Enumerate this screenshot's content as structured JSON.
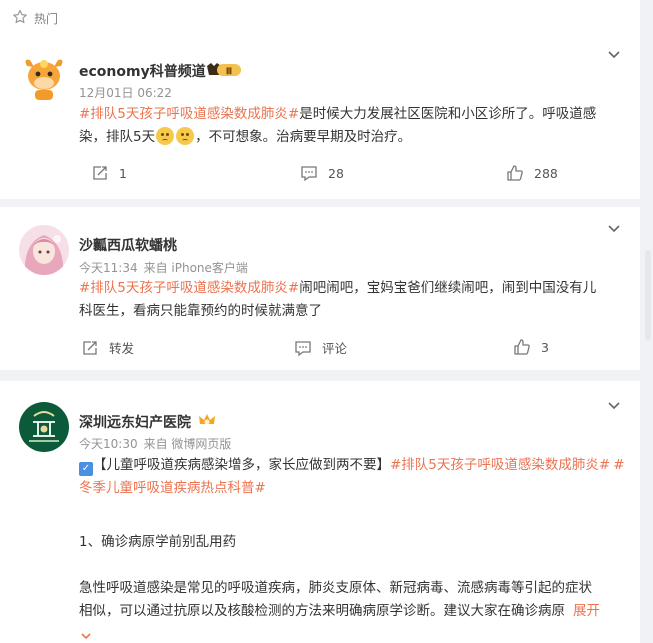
{
  "header": {
    "title": "热门",
    "icon": "star-outline-icon"
  },
  "posts": [
    {
      "author": "economy科普频道",
      "badge": "Ⅲ",
      "time": "12月01日 06:22",
      "source": "",
      "topic": "#排队5天孩子呼吸道感染数成肺炎#",
      "text_1": "是时候大力发展社区医院和小区诊所了。呼吸道感",
      "text_2a": "染，排队5天",
      "text_2b": "，不可想象。治病要早期及时治疗。",
      "emoji": "crying-face-emoji",
      "repost": "1",
      "comment": "28",
      "like": "288"
    },
    {
      "author": "沙瓤西瓜软蟠桃",
      "time": "今天11:34",
      "source": "来自 iPhone客户端",
      "topic": "#排队5天孩子呼吸道感染数成肺炎#",
      "text_1": "闹吧闹吧，宝妈宝爸们继续闹吧，闹到中国没有儿",
      "text_2": "科医生，看病只能靠预约的时候就满意了",
      "repost": "转发",
      "comment": "评论",
      "like": "3"
    },
    {
      "author": "深圳远东妇产医院",
      "time": "今天10:30",
      "source": "来自 微博网页版",
      "checkbox": "✓",
      "line1_text": "【儿童呼吸道疾病感染增多，家长应做到两不要】",
      "line1_topic": "#排队5天孩子呼吸道感染数成肺炎#",
      "line1_hash": "#",
      "line2_topic": "冬季儿童呼吸道疾病热点科普#",
      "para1": "1、确诊病原学前别乱用药",
      "para2_1": "急性呼吸道感染是常见的呼吸道疾病，肺炎支原体、新冠病毒、流感病毒等引起的症状",
      "para2_2": "相似，可以通过抗原以及核酸检测的方法来明确病原学诊断。建议大家在确诊病原",
      "expand": "展开"
    }
  ],
  "colors": {
    "accent": "#eb7350",
    "text": "#333333",
    "meta": "#939393",
    "bg": "#f1f2f5"
  }
}
